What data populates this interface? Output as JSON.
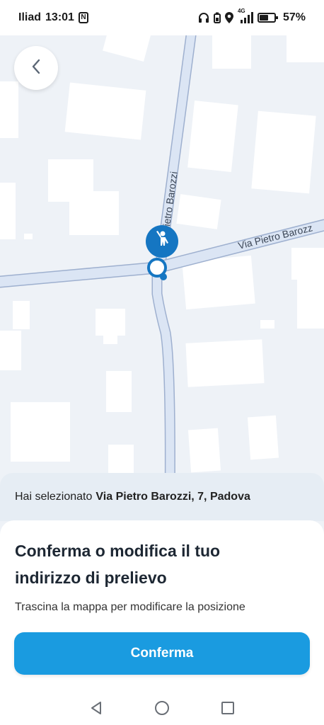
{
  "status_bar": {
    "carrier": "Iliad",
    "time": "13:01",
    "nfc_icon": "nfc-icon",
    "headphones_icon": "headphones-icon",
    "battery_saver_icon": "battery-saver-icon",
    "location_icon": "location-icon",
    "network": "4G",
    "battery_percent": "57%"
  },
  "map": {
    "street_label_vertical": "ietro Barozzi",
    "street_label_horizontal": "Via Pietro Barozz",
    "road_color": "#dbe5f4",
    "road_border_color": "#9eb0cf",
    "building_color": "#ffffff",
    "pin_color": "#1576c2"
  },
  "back_button": {
    "icon": "chevron-left-icon"
  },
  "selection": {
    "prefix": "Hai selezionato",
    "address": "Via Pietro Barozzi, 7, Padova"
  },
  "sheet": {
    "title": "Conferma o modifica il tuo indirizzo di prelievo",
    "subtitle": "Trascina la mappa per modificare la posizione",
    "confirm_label": "Conferma",
    "accent_color": "#1a9be0"
  },
  "nav_bar": {
    "back_icon": "triangle-back-icon",
    "home_icon": "circle-home-icon",
    "recents_icon": "square-recents-icon"
  }
}
